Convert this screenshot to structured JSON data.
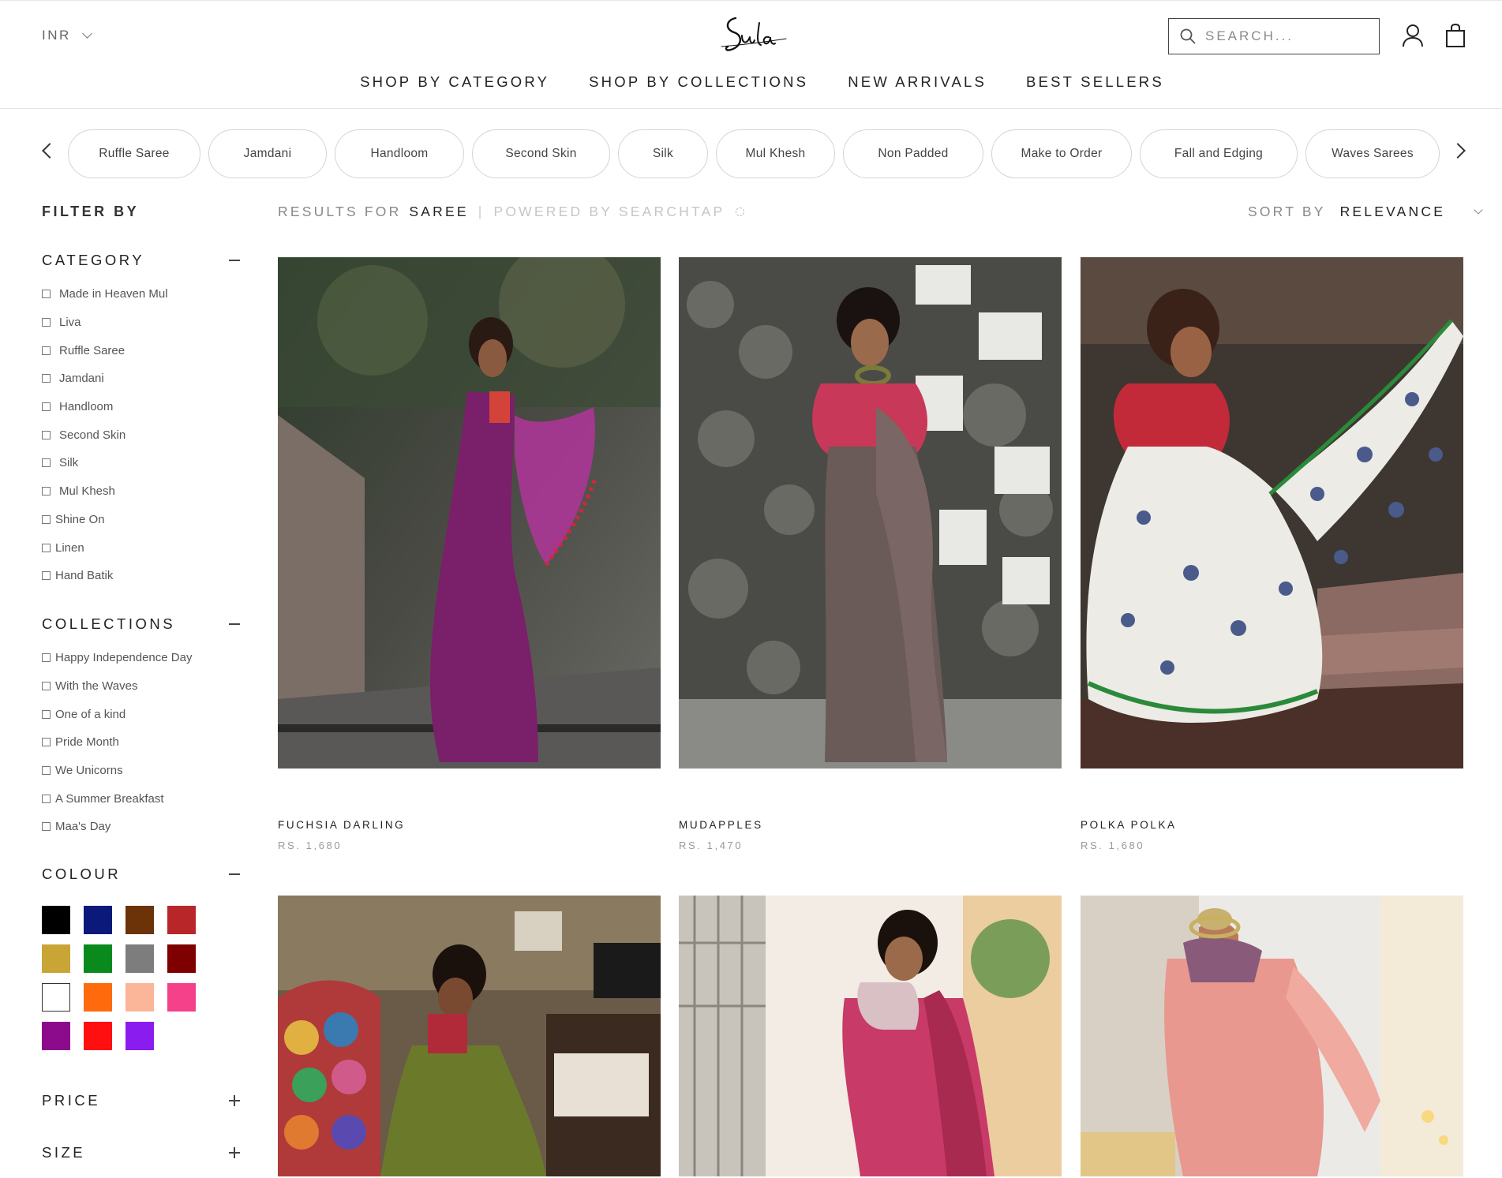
{
  "header": {
    "currency": "INR",
    "search_placeholder": "SEARCH...",
    "nav": [
      "SHOP BY CATEGORY",
      "SHOP BY COLLECTIONS",
      "NEW ARRIVALS",
      "BEST SELLERS"
    ]
  },
  "chips": [
    "Ruffle Saree",
    "Jamdani",
    "Handloom",
    "Second Skin",
    "Silk",
    "Mul Khesh",
    "Non Padded",
    "Make to Order",
    "Fall and Edging",
    "Waves Sarees"
  ],
  "filter": {
    "title": "FILTER BY",
    "category": {
      "title": "CATEGORY",
      "items": [
        "Made in Heaven Mul",
        "Liva",
        "Ruffle Saree",
        "Jamdani",
        "Handloom",
        "Second Skin",
        "Silk",
        "Mul Khesh",
        "Shine On",
        "Linen",
        "Hand Batik"
      ]
    },
    "collections": {
      "title": "COLLECTIONS",
      "items": [
        "Happy Independence Day",
        "With the Waves",
        "One of a kind",
        "Pride Month",
        "We Unicorns",
        "A Summer Breakfast",
        "Maa's Day"
      ]
    },
    "colour": {
      "title": "COLOUR",
      "swatches": [
        "#000000",
        "#0b1a7a",
        "#6b3307",
        "#b8262a",
        "#c9a536",
        "#0a8a1c",
        "#7d7d7d",
        "#7e0000",
        "#ffffff",
        "#ff6a0d",
        "#fbb598",
        "#f5418a",
        "#8c0a8c",
        "#ff1010",
        "#8a1cf0"
      ]
    },
    "price": {
      "title": "PRICE"
    },
    "size": {
      "title": "SIZE"
    }
  },
  "results": {
    "prefix": "RESULTS FOR",
    "query": "SAREE",
    "separator": "|",
    "powered": "POWERED BY SEARCHTAP"
  },
  "sort": {
    "label": "SORT BY",
    "value": "RELEVANCE"
  },
  "products": [
    {
      "name": "FUCHSIA DARLING",
      "price": "RS. 1,680"
    },
    {
      "name": "MUDAPPLES",
      "price": "RS. 1,470"
    },
    {
      "name": "POLKA POLKA",
      "price": "RS. 1,680"
    },
    {
      "name": "",
      "price": ""
    },
    {
      "name": "",
      "price": ""
    },
    {
      "name": "",
      "price": ""
    }
  ]
}
